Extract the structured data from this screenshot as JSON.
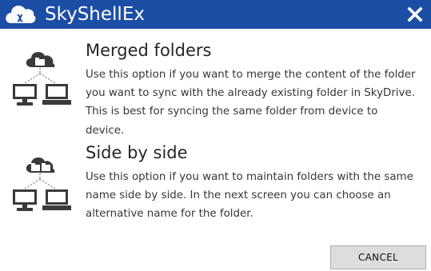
{
  "window": {
    "title": "SkyShellEx"
  },
  "options": [
    {
      "heading": "Merged folders",
      "description": "Use this option if you want to merge the content of the folder you want to sync with the already existing folder in SkyDrive. This is best for syncing the same folder from device to device.",
      "icon": "merged-folders-icon"
    },
    {
      "heading": "Side by side",
      "description": "Use this option if you want to maintain folders with the same name side by side. In the next screen you can choose an alternative name for the folder.",
      "icon": "side-by-side-icon"
    }
  ],
  "buttons": {
    "cancel": "CANCEL"
  },
  "colors": {
    "titlebar": "#1c4ea6",
    "icon": "#3a3a3a",
    "heading": "#262626",
    "text": "#363636",
    "button_bg": "#dddddd",
    "button_border": "#adadad"
  }
}
